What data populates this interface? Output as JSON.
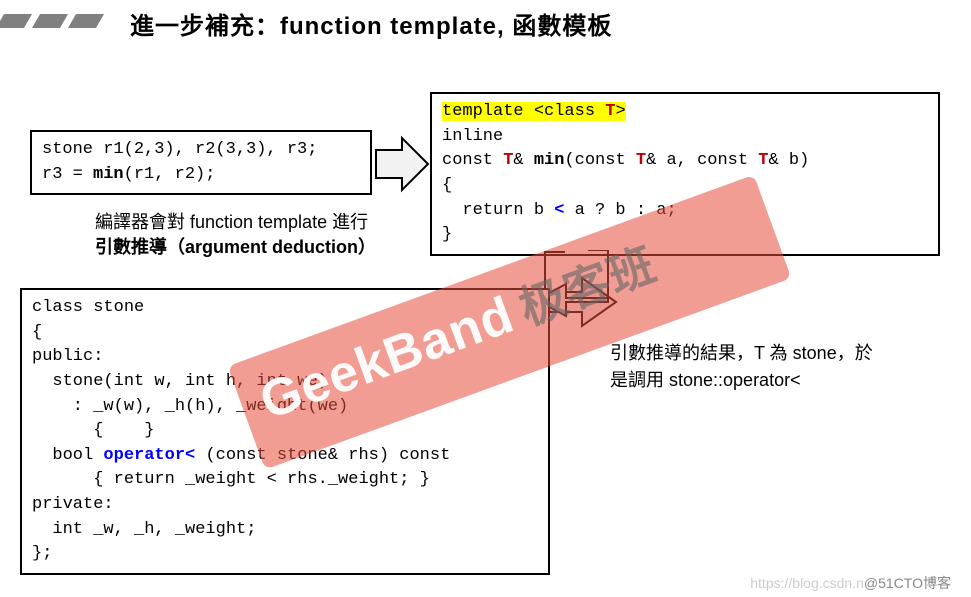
{
  "title": "進一步補充：function template, 函數模板",
  "usage": {
    "line1": "stone r1(2,3), r2(3,3), r3;",
    "line2a": "r3 = ",
    "line2b": "min",
    "line2c": "(r1, r2);"
  },
  "caption1": {
    "l1": "編譯器會對 function template 進行",
    "l2": "引數推導（argument deduction）"
  },
  "tmpl": {
    "t1": "template <class ",
    "t1_T": "T",
    "t1_end": ">",
    "t2": "inline",
    "t3a": "const ",
    "t3_T1": "T",
    "t3b": "& ",
    "t3_min": "min",
    "t3c": "(const ",
    "t3_T2": "T",
    "t3d": "& a, const ",
    "t3_T3": "T",
    "t3e": "& b)",
    "t4": "{",
    "t5a": "  return b ",
    "t5_lt": "<",
    "t5b": " a ? b : a;",
    "t6": "}"
  },
  "caption2": {
    "l1": "引數推導的結果，T 為 stone，於",
    "l2": "是調用 stone::operator<"
  },
  "cls": {
    "c1": "class stone",
    "c2": "{",
    "c3": "public:",
    "c4": "  stone(int w, int h, int we)",
    "c5": "    : _w(w), _h(h), _weight(we)",
    "c6": "      {    }",
    "c7a": "  bool ",
    "c7_op": "operator<",
    "c7b": " (const stone& rhs) const",
    "c8": "      { return _weight < rhs._weight; }",
    "c9": "private:",
    "c10": "  int _w, _h, _weight;",
    "c11": "};"
  },
  "watermark": {
    "main": "GeekBand",
    "cn": "极客班"
  },
  "footer": {
    "light": "https://blog.csdn.n",
    "dark": "@51CTO博客"
  }
}
